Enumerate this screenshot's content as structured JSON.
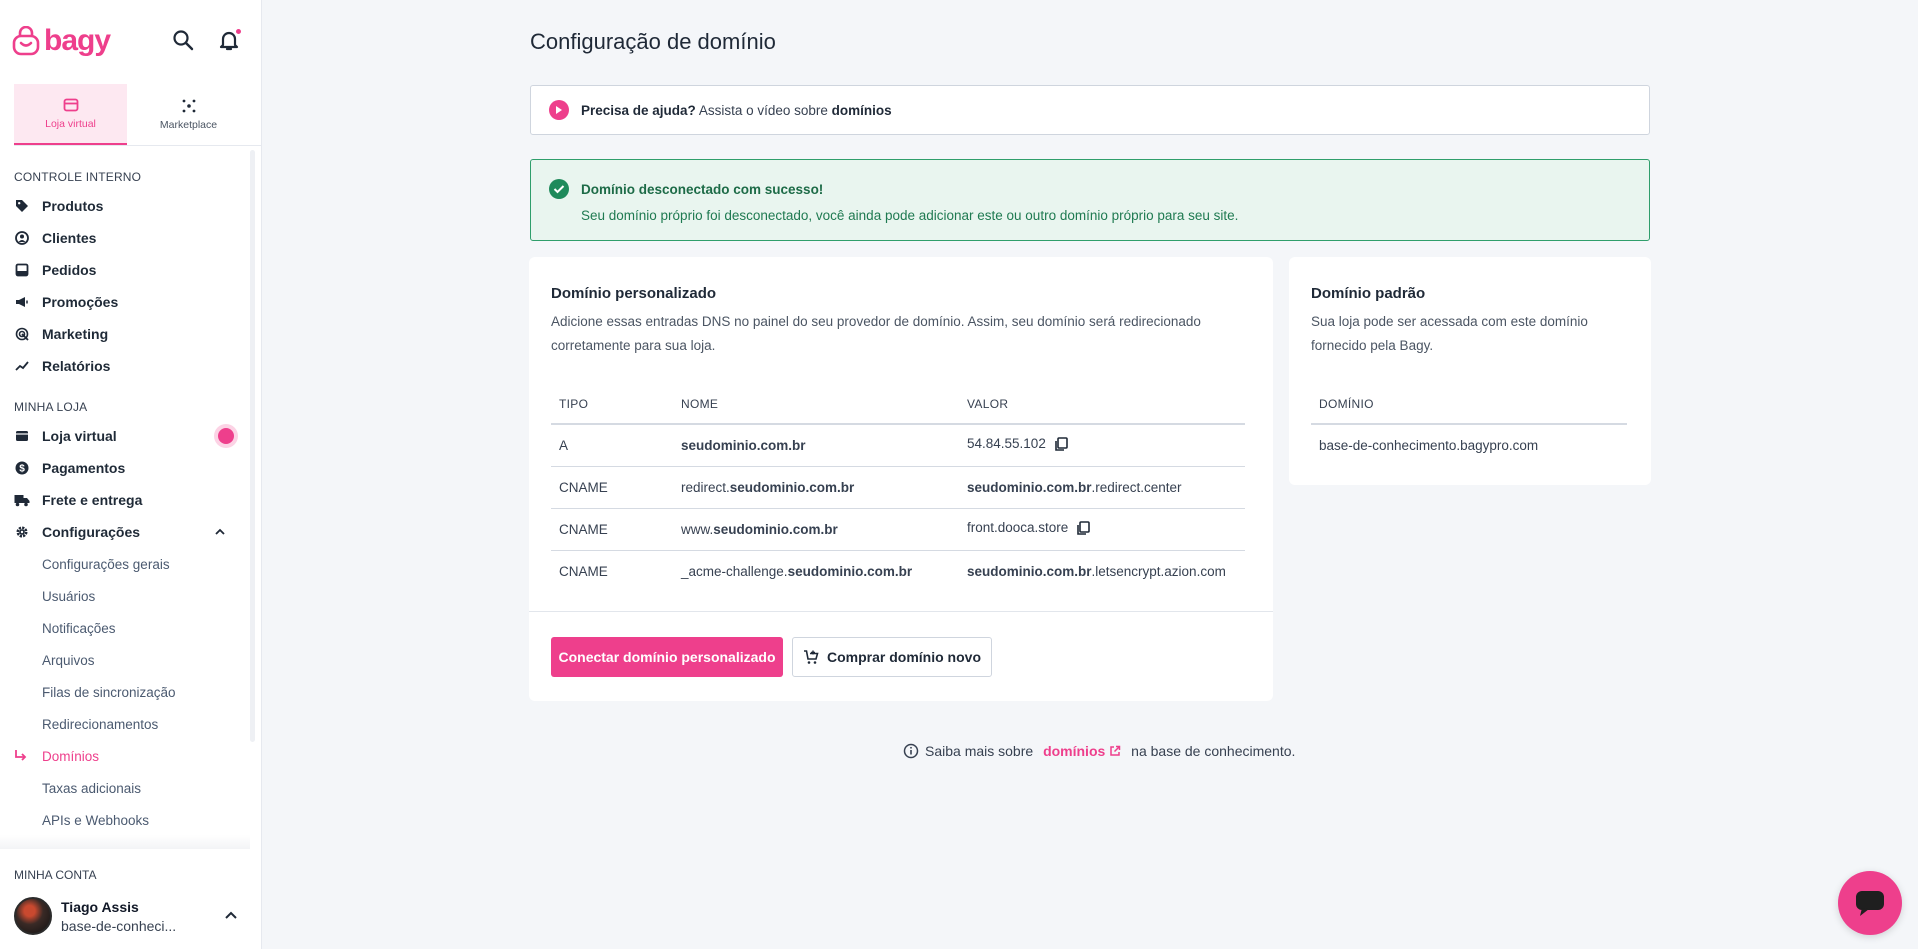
{
  "brand": {
    "logo_text": "bagy",
    "accent": "#ee3f8c"
  },
  "header": {
    "icons": [
      "search-icon",
      "bell-icon"
    ]
  },
  "tabs": [
    {
      "label": "Loja virtual",
      "active": true
    },
    {
      "label": "Marketplace",
      "active": false
    }
  ],
  "sidebar": {
    "section_internal": "CONTROLE INTERNO",
    "internal_items": [
      {
        "label": "Produtos",
        "icon": "tag-icon"
      },
      {
        "label": "Clientes",
        "icon": "user-circle-icon"
      },
      {
        "label": "Pedidos",
        "icon": "inbox-icon"
      },
      {
        "label": "Promoções",
        "icon": "megaphone-icon"
      },
      {
        "label": "Marketing",
        "icon": "target-icon"
      },
      {
        "label": "Relatórios",
        "icon": "chart-icon"
      }
    ],
    "section_store": "MINHA LOJA",
    "store_items": [
      {
        "label": "Loja virtual",
        "icon": "store-icon"
      },
      {
        "label": "Pagamentos",
        "icon": "dollar-icon"
      },
      {
        "label": "Frete e entrega",
        "icon": "truck-icon"
      },
      {
        "label": "Configurações",
        "icon": "gear-icon"
      }
    ],
    "config_subitems": [
      {
        "label": "Configurações gerais"
      },
      {
        "label": "Usuários"
      },
      {
        "label": "Notificações"
      },
      {
        "label": "Arquivos"
      },
      {
        "label": "Filas de sincronização"
      },
      {
        "label": "Redirecionamentos"
      },
      {
        "label": "Domínios",
        "active": true
      },
      {
        "label": "Taxas adicionais"
      },
      {
        "label": "APIs e Webhooks"
      }
    ],
    "section_account": "MINHA CONTA",
    "account": {
      "name": "Tiago Assis",
      "store": "base-de-conheci..."
    }
  },
  "main": {
    "title": "Configuração de domínio",
    "help": {
      "bold": "Precisa de ajuda?",
      "text": " Assista o vídeo sobre ",
      "link": "domínios"
    },
    "alert": {
      "title": "Domínio desconectado com sucesso!",
      "message": "Seu domínio próprio foi desconectado, você ainda pode adicionar este ou outro domínio próprio para seu site."
    },
    "custom": {
      "title": "Domínio personalizado",
      "description": "Adicione essas entradas DNS no painel do seu provedor de domínio. Assim, seu domínio será redirecionado corretamente para sua loja.",
      "columns": [
        "TIPO",
        "NOME",
        "VALOR"
      ],
      "rows": [
        {
          "type": "A",
          "name_pre": "",
          "name_bold": "seudominio.com.br",
          "value_bold": "",
          "value_rest": "54.84.55.102",
          "copy": true
        },
        {
          "type": "CNAME",
          "name_pre": "redirect.",
          "name_bold": "seudominio.com.br",
          "value_bold": "seudominio.com.br",
          "value_rest": ".redirect.center",
          "copy": false
        },
        {
          "type": "CNAME",
          "name_pre": "www.",
          "name_bold": "seudominio.com.br",
          "value_bold": "",
          "value_rest": "front.dooca.store",
          "copy": true
        },
        {
          "type": "CNAME",
          "name_pre": "_acme-challenge.",
          "name_bold": "seudominio.com.br",
          "value_bold": "seudominio.com.br",
          "value_rest": ".letsencrypt.azion.com",
          "copy": false
        }
      ],
      "connect_button": "Conectar domínio personalizado",
      "buy_button": "Comprar domínio novo"
    },
    "default": {
      "title": "Domínio padrão",
      "description": "Sua loja pode ser acessada com este domínio fornecido pela Bagy.",
      "column": "DOMÍNIO",
      "domain": "base-de-conhecimento.bagypro.com"
    },
    "footer": {
      "pre": "Saiba mais sobre ",
      "link": "domínios",
      "post": " na base de conhecimento."
    }
  }
}
